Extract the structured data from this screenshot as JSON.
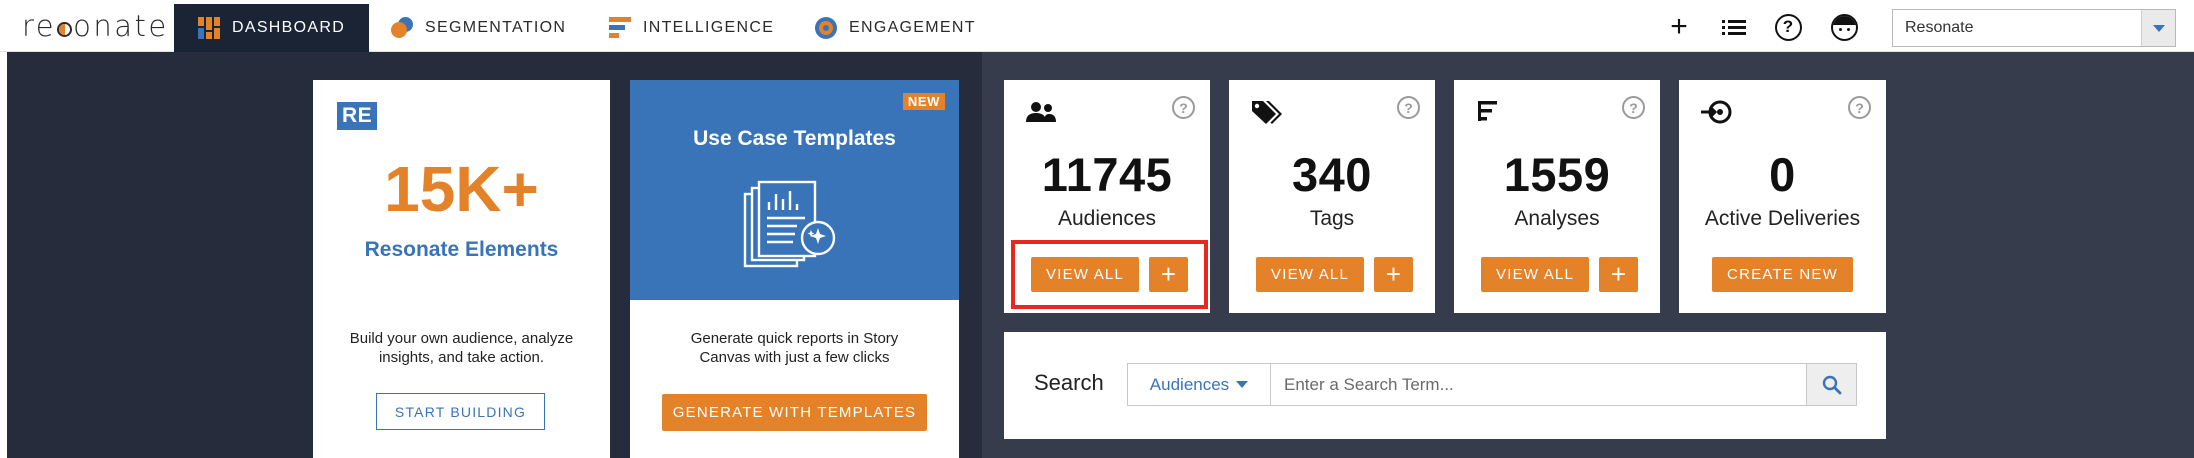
{
  "app": {
    "logo": "resonate"
  },
  "nav": {
    "tabs": [
      {
        "label": "DASHBOARD",
        "icon": "dashboard-grid-icon"
      },
      {
        "label": "SEGMENTATION",
        "icon": "segmentation-circles-icon"
      },
      {
        "label": "INTELLIGENCE",
        "icon": "intelligence-bars-icon"
      },
      {
        "label": "ENGAGEMENT",
        "icon": "engagement-target-icon"
      }
    ],
    "active_tab": "DASHBOARD",
    "actions": [
      "plus-icon",
      "list-icon",
      "help-icon",
      "avatar-icon"
    ],
    "account": {
      "selected": "Resonate"
    }
  },
  "cards": {
    "elements": {
      "badge": "RE",
      "stat": "15K+",
      "title": "Resonate Elements",
      "description": "Build your own audience, analyze insights, and take action.",
      "button": "START BUILDING"
    },
    "templates": {
      "badge": "NEW",
      "title": "Use Case Templates",
      "description": "Generate quick reports in Story Canvas with just a few clicks",
      "button": "GENERATE WITH TEMPLATES"
    }
  },
  "stats": [
    {
      "count": "11745",
      "label": "Audiences",
      "icon": "people-icon",
      "primary_button": "VIEW ALL",
      "add_button": "+"
    },
    {
      "count": "340",
      "label": "Tags",
      "icon": "tags-icon",
      "primary_button": "VIEW ALL",
      "add_button": "+"
    },
    {
      "count": "1559",
      "label": "Analyses",
      "icon": "analysis-bars-icon",
      "primary_button": "VIEW ALL",
      "add_button": "+"
    },
    {
      "count": "0",
      "label": "Active Deliveries",
      "icon": "delivery-icon",
      "primary_button": "CREATE NEW"
    }
  ],
  "search": {
    "label": "Search",
    "scope": "Audiences",
    "placeholder": "Enter a Search Term..."
  },
  "colors": {
    "accent": "#e4822a",
    "brand_blue": "#3a74b8",
    "nav_dark": "#1a2435",
    "background_dark": "#363c4b",
    "panel_dark": "#262c3b",
    "highlight_red": "#e8281e"
  }
}
